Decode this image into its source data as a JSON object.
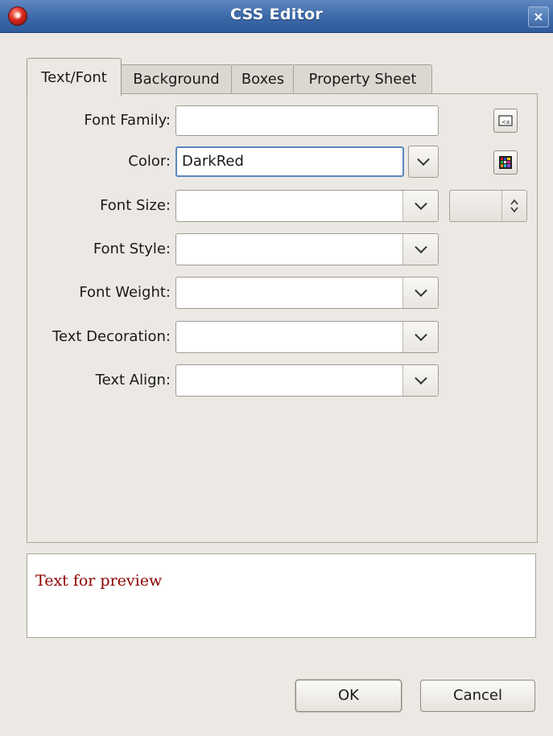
{
  "window": {
    "title": "CSS Editor",
    "close_glyph": "×"
  },
  "tabs": [
    {
      "label": "Text/Font",
      "active": true
    },
    {
      "label": "Background",
      "active": false
    },
    {
      "label": "Boxes",
      "active": false
    },
    {
      "label": "Property Sheet",
      "active": false
    }
  ],
  "fields": {
    "font_family": {
      "label": "Font Family:",
      "value": ""
    },
    "color": {
      "label": "Color:",
      "value": "DarkRed"
    },
    "font_size": {
      "label": "Font Size:",
      "value": ""
    },
    "font_style": {
      "label": "Font Style:",
      "value": ""
    },
    "font_weight": {
      "label": "Font Weight:",
      "value": ""
    },
    "text_decoration": {
      "label": "Text Decoration:",
      "value": ""
    },
    "text_align": {
      "label": "Text Align:",
      "value": ""
    }
  },
  "preview": {
    "text": "Text for preview",
    "color": "#8b0000"
  },
  "buttons": {
    "ok": "OK",
    "cancel": "Cancel"
  },
  "icons": {
    "app": "app-logo-icon",
    "font_chooser": "font-chooser-icon",
    "color_picker": "color-palette-icon",
    "spinner": "spinner-arrows-icon"
  }
}
